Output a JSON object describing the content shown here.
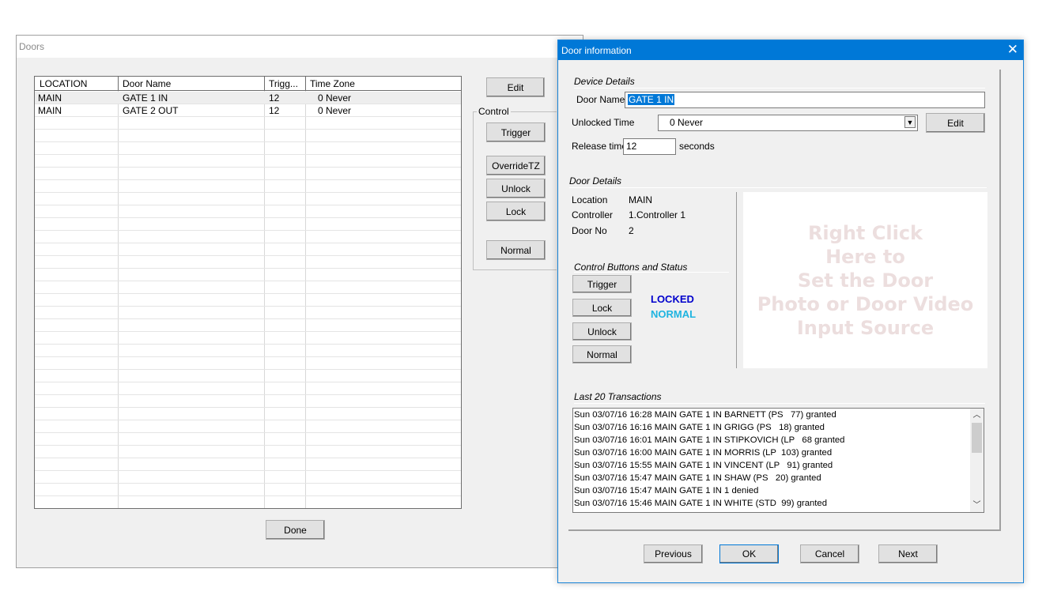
{
  "doors_window": {
    "title": "Doors",
    "columns": [
      "LOCATION",
      "Door Name",
      "Trigg...",
      "Time Zone"
    ],
    "rows": [
      [
        "MAIN",
        "GATE 1 IN",
        "12",
        "0 Never"
      ],
      [
        "MAIN",
        "GATE 2 OUT",
        "12",
        "0 Never"
      ]
    ],
    "edit_label": "Edit",
    "control_group_label": "Control",
    "trigger_label": "Trigger",
    "override_label": "OverrideTZ",
    "unlock_label": "Unlock",
    "lock_label": "Lock",
    "normal_label": "Normal",
    "done_label": "Done"
  },
  "info_dialog": {
    "title": "Door information",
    "close_glyph": "✕",
    "device_details": {
      "heading": "Device Details",
      "door_name_label": "Door Name",
      "door_name_value": "GATE 1 IN",
      "unlocked_time_label": "Unlocked Time",
      "unlocked_time_value": "0 Never",
      "edit_label": "Edit",
      "release_time_label": "Release time",
      "release_time_value": "12",
      "release_unit": "seconds"
    },
    "door_details": {
      "heading": "Door Details",
      "location_label": "Location",
      "location_value": "MAIN",
      "controller_label": "Controller",
      "controller_value": "1.Controller 1",
      "door_no_label": "Door No",
      "door_no_value": "2"
    },
    "photo_placeholder": "Right Click\nHere to\nSet the Door\nPhoto or Door Video\nInput Source",
    "control_buttons": {
      "heading": "Control Buttons and Status",
      "trigger_label": "Trigger",
      "lock_label": "Lock",
      "unlock_label": "Unlock",
      "normal_label": "Normal",
      "status_lock": "LOCKED",
      "status_mode": "NORMAL",
      "status_lock_color": "#0000cc",
      "status_mode_color": "#1fb4e0"
    },
    "transactions": {
      "heading": "Last 20 Transactions",
      "items": [
        "Sun 03/07/16 16:28 MAIN GATE 1 IN BARNETT (PS   77) granted",
        "Sun 03/07/16 16:16 MAIN GATE 1 IN GRIGG (PS   18) granted",
        "Sun 03/07/16 16:01 MAIN GATE 1 IN STIPKOVICH (LP   68 granted",
        "Sun 03/07/16 16:00 MAIN GATE 1 IN MORRIS (LP  103) granted",
        "Sun 03/07/16 15:55 MAIN GATE 1 IN VINCENT (LP   91) granted",
        "Sun 03/07/16 15:47 MAIN GATE 1 IN SHAW (PS   20) granted",
        "Sun 03/07/16 15:47 MAIN GATE 1 IN 1 denied",
        "Sun 03/07/16 15:46 MAIN GATE 1 IN WHITE (STD  99) granted"
      ]
    },
    "buttons": {
      "previous": "Previous",
      "ok": "OK",
      "cancel": "Cancel",
      "next": "Next"
    }
  }
}
